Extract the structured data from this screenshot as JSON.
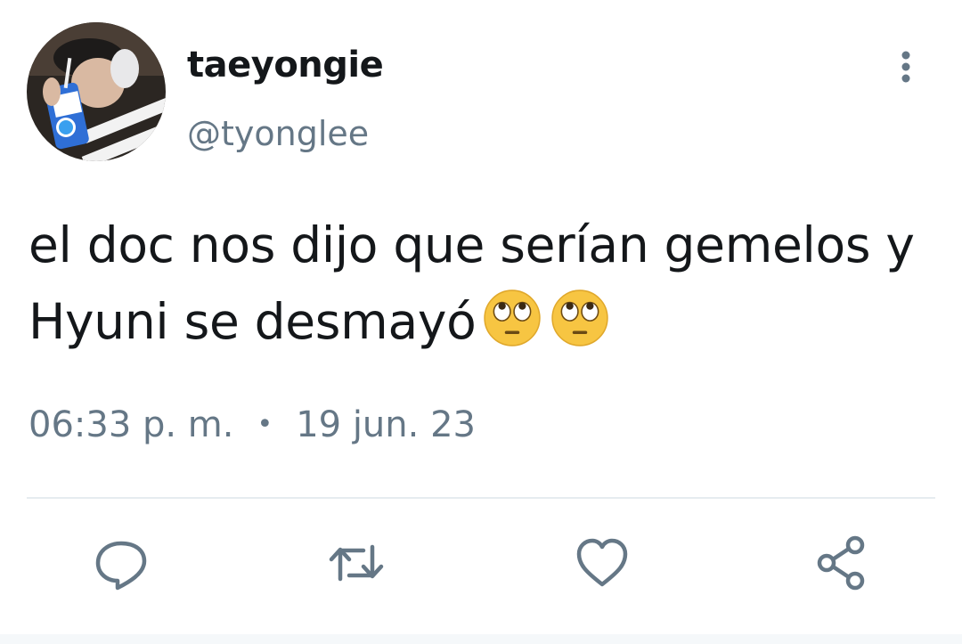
{
  "tweet": {
    "display_name": "taeyongie",
    "handle": "@tyonglee",
    "text_line1": "el doc nos dijo que serían gemelos y",
    "text_line2": "Hyuni se desmayó",
    "emojis": [
      "face-with-rolling-eyes",
      "face-with-rolling-eyes"
    ],
    "time": "06:33 p. m.",
    "separator": "•",
    "date": "19 jun. 23"
  },
  "header": {
    "more_icon": "vertical-ellipsis-icon"
  },
  "actions": [
    {
      "icon": "reply-icon"
    },
    {
      "icon": "retweet-icon"
    },
    {
      "icon": "like-icon"
    },
    {
      "icon": "share-icon"
    }
  ],
  "colors": {
    "text_primary": "#14171a",
    "text_secondary": "#657786",
    "divider": "#e6ecf0",
    "action_icon": "#657786"
  }
}
